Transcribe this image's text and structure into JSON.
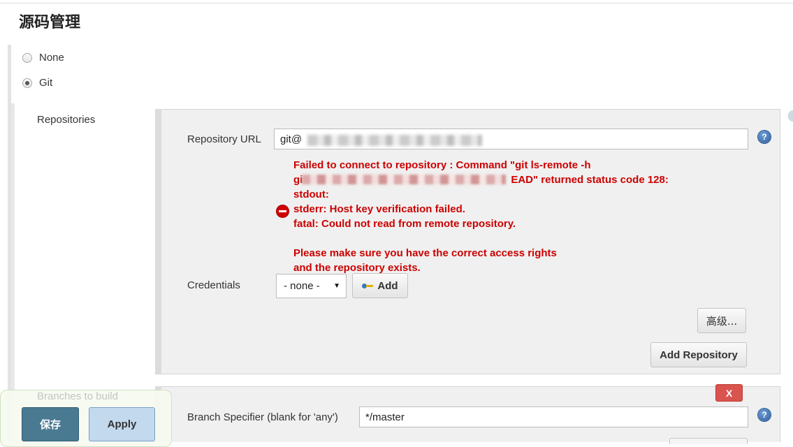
{
  "section": {
    "title": "源码管理"
  },
  "scm_options": [
    {
      "label": "None",
      "checked": false
    },
    {
      "label": "Git",
      "checked": true
    }
  ],
  "repositories": {
    "label": "Repositories",
    "url_label": "Repository URL",
    "url_value": "git@",
    "help_icon": "help-icon",
    "error": {
      "icon": "error-icon",
      "lines": [
        "Failed to connect to repository : Command \"git ls-remote -h",
        "gi",
        "EAD\" returned status code 128:",
        "stdout:",
        "stderr: Host key verification failed.",
        "fatal: Could not read from remote repository.",
        "",
        "Please make sure you have the correct access rights",
        "and the repository exists."
      ]
    },
    "credentials_label": "Credentials",
    "credentials_value": "- none -",
    "add_label": "Add",
    "advanced_label": "高级...",
    "add_repository_label": "Add Repository",
    "delete_label": "X"
  },
  "branches": {
    "label": "Branches to build",
    "specifier_label": "Branch Specifier (blank for 'any')",
    "specifier_value": "*/master"
  },
  "footer": {
    "save_label": "保存",
    "apply_label": "Apply"
  },
  "colors": {
    "error": "#cc0000",
    "save_button": "#4a7a92",
    "apply_button": "#c3d9ee",
    "delete_button": "#d9534f"
  }
}
